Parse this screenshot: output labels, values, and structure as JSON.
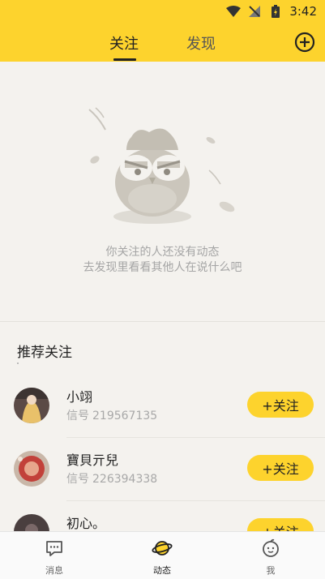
{
  "status_bar": {
    "time": "3:42"
  },
  "header": {
    "tabs": [
      {
        "label": "关注",
        "active": true
      },
      {
        "label": "发现",
        "active": false
      }
    ]
  },
  "empty_state": {
    "line1": "你关注的人还没有动态",
    "line2": "去发现里看看其他人在说什么吧"
  },
  "recommend": {
    "title": "推荐关注",
    "id_label": "信号",
    "follow_label": "+关注",
    "users": [
      {
        "name": "小翊",
        "id": "219567135"
      },
      {
        "name": "寶貝亓兒",
        "id": "226394338"
      },
      {
        "name": "初心。",
        "id": ""
      }
    ]
  },
  "tabbar": {
    "items": [
      {
        "label": "消息",
        "icon": "message-icon",
        "active": false
      },
      {
        "label": "动态",
        "icon": "planet-icon",
        "active": true
      },
      {
        "label": "我",
        "icon": "face-icon",
        "active": false
      }
    ]
  },
  "colors": {
    "accent": "#fdd32d",
    "background": "#f4f2ee"
  }
}
